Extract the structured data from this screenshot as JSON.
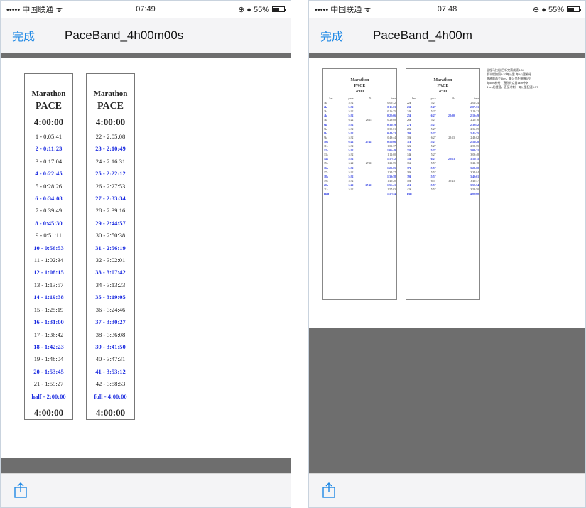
{
  "left": {
    "status": {
      "carrier": "••••• 中国联通 ᯤ",
      "time": "07:49",
      "indicators": "⊕ ● 55%",
      "battery_fraction": 0.55
    },
    "nav": {
      "done_label": "完成",
      "title": "PaceBand_4h00m00s"
    },
    "cards": [
      {
        "heading1": "Marathon",
        "heading2": "PACE",
        "heading3": "4:00:00",
        "splits": [
          {
            "text": "1 - 0:05:41",
            "bold": false
          },
          {
            "text": "2 - 0:11:23",
            "bold": true
          },
          {
            "text": "3 - 0:17:04",
            "bold": false
          },
          {
            "text": "4 - 0:22:45",
            "bold": true
          },
          {
            "text": "5 - 0:28:26",
            "bold": false
          },
          {
            "text": "6 - 0:34:08",
            "bold": true
          },
          {
            "text": "7 - 0:39:49",
            "bold": false
          },
          {
            "text": "8 - 0:45:30",
            "bold": true
          },
          {
            "text": "9 - 0:51:11",
            "bold": false
          },
          {
            "text": "10 - 0:56:53",
            "bold": true
          },
          {
            "text": "11 - 1:02:34",
            "bold": false
          },
          {
            "text": "12 - 1:08:15",
            "bold": true
          },
          {
            "text": "13 - 1:13:57",
            "bold": false
          },
          {
            "text": "14 - 1:19:38",
            "bold": true
          },
          {
            "text": "15 - 1:25:19",
            "bold": false
          },
          {
            "text": "16 - 1:31:00",
            "bold": true
          },
          {
            "text": "17 - 1:36:42",
            "bold": false
          },
          {
            "text": "18 - 1:42:23",
            "bold": true
          },
          {
            "text": "19 - 1:48:04",
            "bold": false
          },
          {
            "text": "20 - 1:53:45",
            "bold": true
          },
          {
            "text": "21 - 1:59:27",
            "bold": false
          },
          {
            "text": "half - 2:00:00",
            "bold": true
          }
        ],
        "footer": "4:00:00"
      },
      {
        "heading1": "Marathon",
        "heading2": "PACE",
        "heading3": "4:00:00",
        "splits": [
          {
            "text": "22 - 2:05:08",
            "bold": false
          },
          {
            "text": "23 - 2:10:49",
            "bold": true
          },
          {
            "text": "24 - 2:16:31",
            "bold": false
          },
          {
            "text": "25 - 2:22:12",
            "bold": true
          },
          {
            "text": "26 - 2:27:53",
            "bold": false
          },
          {
            "text": "27 - 2:33:34",
            "bold": true
          },
          {
            "text": "28 - 2:39:16",
            "bold": false
          },
          {
            "text": "29 - 2:44:57",
            "bold": true
          },
          {
            "text": "30 - 2:50:38",
            "bold": false
          },
          {
            "text": "31 - 2:56:19",
            "bold": true
          },
          {
            "text": "32 - 3:02:01",
            "bold": false
          },
          {
            "text": "33 - 3:07:42",
            "bold": true
          },
          {
            "text": "34 - 3:13:23",
            "bold": false
          },
          {
            "text": "35 - 3:19:05",
            "bold": true
          },
          {
            "text": "36 - 3:24:46",
            "bold": false
          },
          {
            "text": "37 - 3:30:27",
            "bold": true
          },
          {
            "text": "38 - 3:36:08",
            "bold": false
          },
          {
            "text": "39 - 3:41:50",
            "bold": true
          },
          {
            "text": "40 - 3:47:31",
            "bold": false
          },
          {
            "text": "41 - 3:53:12",
            "bold": true
          },
          {
            "text": "42 - 3:58:53",
            "bold": false
          },
          {
            "text": "full - 4:00:00",
            "bold": true
          }
        ],
        "footer": "4:00:00"
      }
    ]
  },
  "right": {
    "status": {
      "carrier": "••••• 中国联通 ᯤ",
      "time": "07:48",
      "indicators": "⊕ ● 55%",
      "battery_fraction": 0.55
    },
    "nav": {
      "done_label": "完成",
      "title": "PaceBand_4h00m"
    },
    "columns": [
      "km",
      "pace",
      "5k",
      "time"
    ],
    "cards": [
      {
        "heading1": "Marathon",
        "heading2": "PACE",
        "heading3": "4:00",
        "rows": [
          {
            "cells": [
              "1k",
              "5:32",
              "",
              "0:05:32"
            ],
            "bold": false
          },
          {
            "cells": [
              "2k",
              "5:32",
              "",
              "0:11:03"
            ],
            "bold": true
          },
          {
            "cells": [
              "3k",
              "5:32",
              "",
              "0:16:35"
            ],
            "bold": false
          },
          {
            "cells": [
              "4k",
              "5:32",
              "",
              "0:22:06"
            ],
            "bold": true
          },
          {
            "cells": [
              "5k",
              "6:22",
              "28:18",
              "0:28:08"
            ],
            "bold": false
          },
          {
            "cells": [
              "6k",
              "5:32",
              "",
              "0:33:39"
            ],
            "bold": true
          },
          {
            "cells": [
              "7k",
              "5:32",
              "",
              "0:39:01"
            ],
            "bold": false
          },
          {
            "cells": [
              "8k",
              "5:32",
              "",
              "0:44:32"
            ],
            "bold": true
          },
          {
            "cells": [
              "9k",
              "5:32",
              "",
              "0:49:44"
            ],
            "bold": false
          },
          {
            "cells": [
              "10k",
              "6:22",
              "27:48",
              "0:56:06"
            ],
            "bold": true
          },
          {
            "cells": [
              "11k",
              "5:32",
              "",
              "1:01:37"
            ],
            "bold": false
          },
          {
            "cells": [
              "12k",
              "5:32",
              "",
              "1:06:49"
            ],
            "bold": true
          },
          {
            "cells": [
              "13k",
              "5:32",
              "",
              "1:12:00"
            ],
            "bold": false
          },
          {
            "cells": [
              "14k",
              "5:32",
              "",
              "1:17:32"
            ],
            "bold": true
          },
          {
            "cells": [
              "15k",
              "6:22",
              "27:48",
              "1:23:55"
            ],
            "bold": false
          },
          {
            "cells": [
              "16k",
              "5:32",
              "",
              "1:29:05"
            ],
            "bold": true
          },
          {
            "cells": [
              "17k",
              "5:32",
              "",
              "1:34:37"
            ],
            "bold": false
          },
          {
            "cells": [
              "18k",
              "5:32",
              "",
              "1:39:58"
            ],
            "bold": true
          },
          {
            "cells": [
              "19k",
              "5:32",
              "",
              "1:45:20"
            ],
            "bold": false
          },
          {
            "cells": [
              "20k",
              "6:22",
              "27:48",
              "1:51:41"
            ],
            "bold": true
          },
          {
            "cells": [
              "21k",
              "5:32",
              "",
              "1:57:03"
            ],
            "bold": false
          },
          {
            "cells": [
              "Half",
              "",
              "",
              "1:57:54"
            ],
            "bold": true
          }
        ]
      },
      {
        "heading1": "Marathon",
        "heading2": "PACE",
        "heading3": "4:00",
        "rows": [
          {
            "cells": [
              "22k",
              "5:27",
              "",
              "2:02:24"
            ],
            "bold": false
          },
          {
            "cells": [
              "23k",
              "5:27",
              "",
              "2:07:51"
            ],
            "bold": true
          },
          {
            "cells": [
              "24k",
              "5:27",
              "",
              "2:13:22"
            ],
            "bold": false
          },
          {
            "cells": [
              "25k",
              "6:27",
              "28:00",
              "2:19:49"
            ],
            "bold": true
          },
          {
            "cells": [
              "26k",
              "5:27",
              "",
              "2:25:16"
            ],
            "bold": false
          },
          {
            "cells": [
              "27k",
              "5:27",
              "",
              "2:30:42"
            ],
            "bold": true
          },
          {
            "cells": [
              "28k",
              "5:27",
              "",
              "2:36:09"
            ],
            "bold": false
          },
          {
            "cells": [
              "29k",
              "5:27",
              "",
              "2:41:35"
            ],
            "bold": true
          },
          {
            "cells": [
              "30k",
              "6:27",
              "28:13",
              "2:48:02"
            ],
            "bold": false
          },
          {
            "cells": [
              "31k",
              "5:27",
              "",
              "2:53:28"
            ],
            "bold": true
          },
          {
            "cells": [
              "32k",
              "5:27",
              "",
              "2:58:55"
            ],
            "bold": false
          },
          {
            "cells": [
              "33k",
              "5:27",
              "",
              "3:04:21"
            ],
            "bold": true
          },
          {
            "cells": [
              "34k",
              "5:27",
              "",
              "3:09:48"
            ],
            "bold": false
          },
          {
            "cells": [
              "35k",
              "6:27",
              "28:13",
              "3:16:15"
            ],
            "bold": true
          },
          {
            "cells": [
              "36k",
              "5:57",
              "",
              "3:22:18"
            ],
            "bold": false
          },
          {
            "cells": [
              "37k",
              "5:57",
              "",
              "3:28:00"
            ],
            "bold": true
          },
          {
            "cells": [
              "38k",
              "5:57",
              "",
              "3:34:04"
            ],
            "bold": false
          },
          {
            "cells": [
              "39k",
              "5:57",
              "",
              "3:40:01"
            ],
            "bold": true
          },
          {
            "cells": [
              "40k",
              "6:57",
              "30:43",
              "3:46:57"
            ],
            "bold": false
          },
          {
            "cells": [
              "41k",
              "5:57",
              "",
              "3:52:54"
            ],
            "bold": true
          },
          {
            "cells": [
              "42k",
              "5:57",
              "",
              "3:58:50"
            ],
            "bold": false
          },
          {
            "cells": [
              "Full",
              "",
              "",
              "4:00:00"
            ],
            "bold": true
          }
        ]
      }
    ],
    "notes": [
      "全程马拉松 目标完赛成绩4:00",
      "前半程按照5:32每公里 每5公里补给",
      "跨越前两个5km，每公里配速降5秒",
      "每5km补给，直到终点前1km冲刺",
      "4 km后提速，直至冲刺，每公里配速5:57"
    ]
  }
}
